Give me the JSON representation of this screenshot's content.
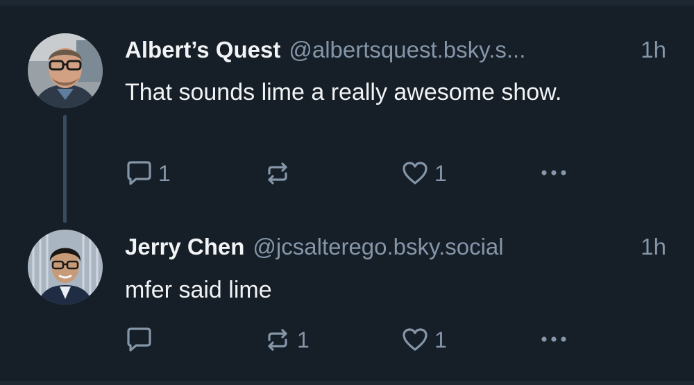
{
  "colors": {
    "background": "#161e27",
    "text": "#f1f3f5",
    "muted": "#8596a9",
    "thread_line": "#3a4b5e"
  },
  "posts": [
    {
      "author": "Albert’s Quest",
      "handle": "@albertsquest.bsky.s...",
      "time": "1h",
      "text": "That sounds lime a really awesome show.",
      "reply_count": "1",
      "repost_count": "",
      "like_count": "1"
    },
    {
      "author": "Jerry Chen",
      "handle": "@jcsalterego.bsky.social",
      "time": "1h",
      "text": "mfer said lime",
      "reply_count": "",
      "repost_count": "1",
      "like_count": "1"
    }
  ],
  "icons": {
    "reply": "speech-bubble-icon",
    "repost": "repost-arrows-icon",
    "like": "heart-icon",
    "more": "ellipsis-icon"
  }
}
